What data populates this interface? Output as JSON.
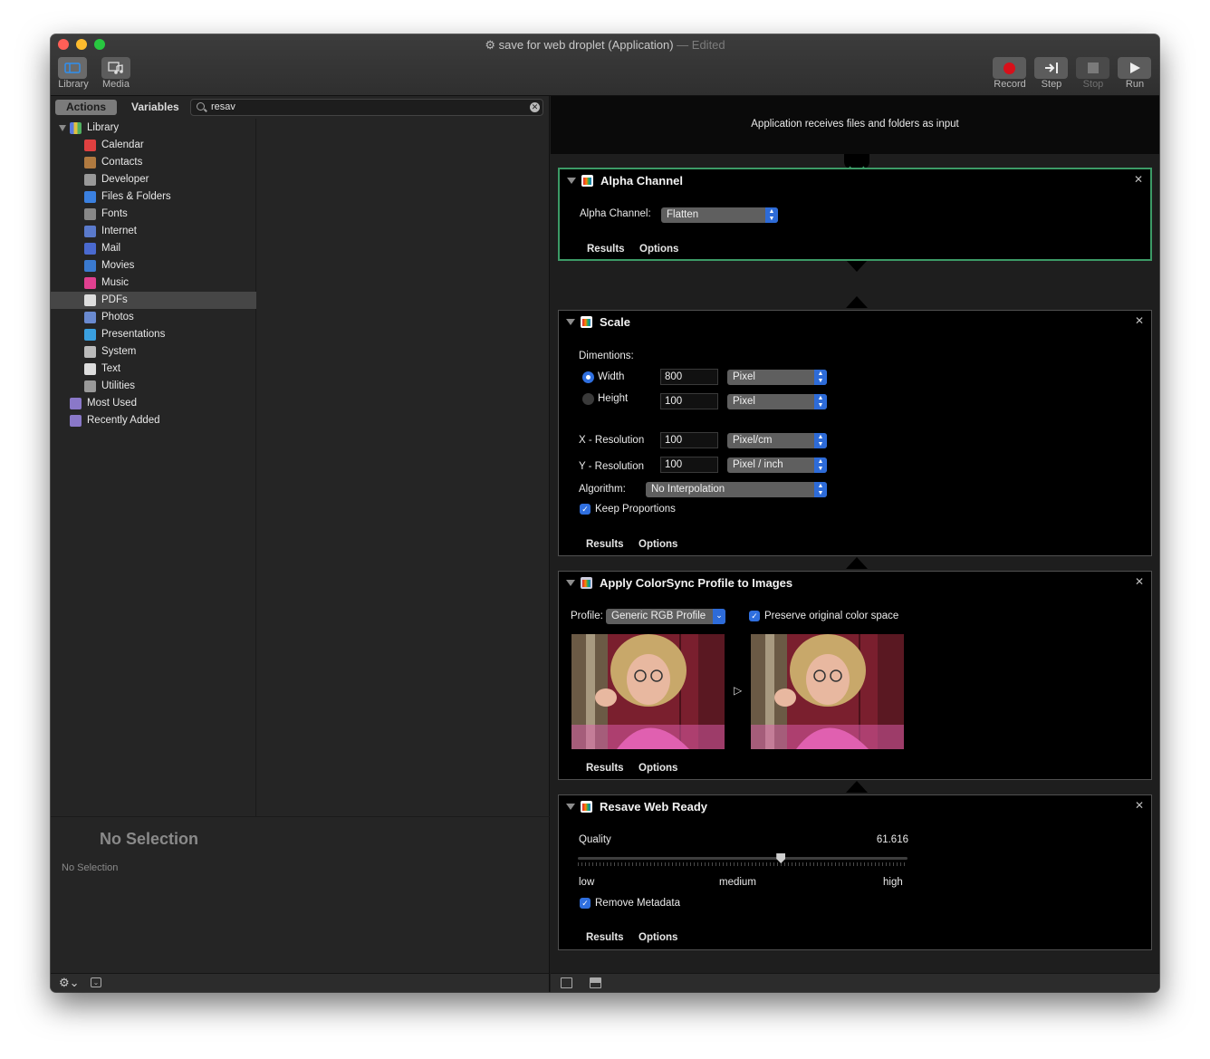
{
  "window": {
    "title": "save for web droplet (Application)",
    "edited": "— Edited",
    "traffic_light_colors": [
      "#ff5f57",
      "#febc2e",
      "#28c840"
    ]
  },
  "toolbar": {
    "library_label": "Library",
    "media_label": "Media",
    "record_label": "Record",
    "step_label": "Step",
    "stop_label": "Stop",
    "run_label": "Run",
    "record_color": "#d7101a"
  },
  "left_panel": {
    "tab_actions": "Actions",
    "tab_variables": "Variables",
    "search_value": "resav",
    "library": {
      "label": "Library",
      "items": [
        {
          "label": "Calendar",
          "icon": "calendar-icon"
        },
        {
          "label": "Contacts",
          "icon": "contacts-icon"
        },
        {
          "label": "Developer",
          "icon": "developer-icon"
        },
        {
          "label": "Files & Folders",
          "icon": "files-folders-icon"
        },
        {
          "label": "Fonts",
          "icon": "fonts-icon"
        },
        {
          "label": "Internet",
          "icon": "internet-icon"
        },
        {
          "label": "Mail",
          "icon": "mail-icon"
        },
        {
          "label": "Movies",
          "icon": "movies-icon"
        },
        {
          "label": "Music",
          "icon": "music-icon"
        },
        {
          "label": "PDFs",
          "icon": "pdf-icon"
        },
        {
          "label": "Photos",
          "icon": "photos-icon"
        },
        {
          "label": "Presentations",
          "icon": "presentations-icon"
        },
        {
          "label": "System",
          "icon": "system-icon"
        },
        {
          "label": "Text",
          "icon": "text-icon"
        },
        {
          "label": "Utilities",
          "icon": "utilities-icon"
        }
      ],
      "selected": "PDFs"
    },
    "most_used": "Most Used",
    "recently_added": "Recently Added",
    "no_selection_title": "No Selection",
    "no_selection_sub": "No Selection"
  },
  "workflow": {
    "header": "Application receives files and folders as input",
    "alpha": {
      "title": "Alpha Channel",
      "field_label": "Alpha Channel:",
      "value": "Flatten"
    },
    "scale": {
      "title": "Scale",
      "dimensions_label": "Dimentions:",
      "width_label": "Width",
      "width_value": "800",
      "width_unit": "Pixel",
      "height_label": "Height",
      "height_value": "100",
      "height_unit": "Pixel",
      "xres_label": "X - Resolution",
      "xres_value": "100",
      "xres_unit": "Pixel/cm",
      "yres_label": "Y - Resolution",
      "yres_value": "100",
      "yres_unit": "Pixel / inch",
      "algorithm_label": "Algorithm:",
      "algorithm_value": "No Interpolation",
      "keep_label": "Keep Proportions",
      "width_selected": true,
      "keep_checked": true
    },
    "colorsync": {
      "title": "Apply ColorSync Profile to Images",
      "profile_label": "Profile:",
      "profile_value": "Generic RGB Profile",
      "preserve_label": "Preserve original color space",
      "preserve_checked": true
    },
    "resave": {
      "title": "Resave Web Ready",
      "quality_label": "Quality",
      "quality_value": "61.616",
      "quality_fraction": 0.616,
      "low_label": "low",
      "medium_label": "medium",
      "high_label": "high",
      "remove_label": "Remove Metadata",
      "remove_checked": true
    },
    "results_label": "Results",
    "options_label": "Options"
  },
  "accent_color": "#2f6fdf",
  "selected_border_color": "#3c9a66"
}
